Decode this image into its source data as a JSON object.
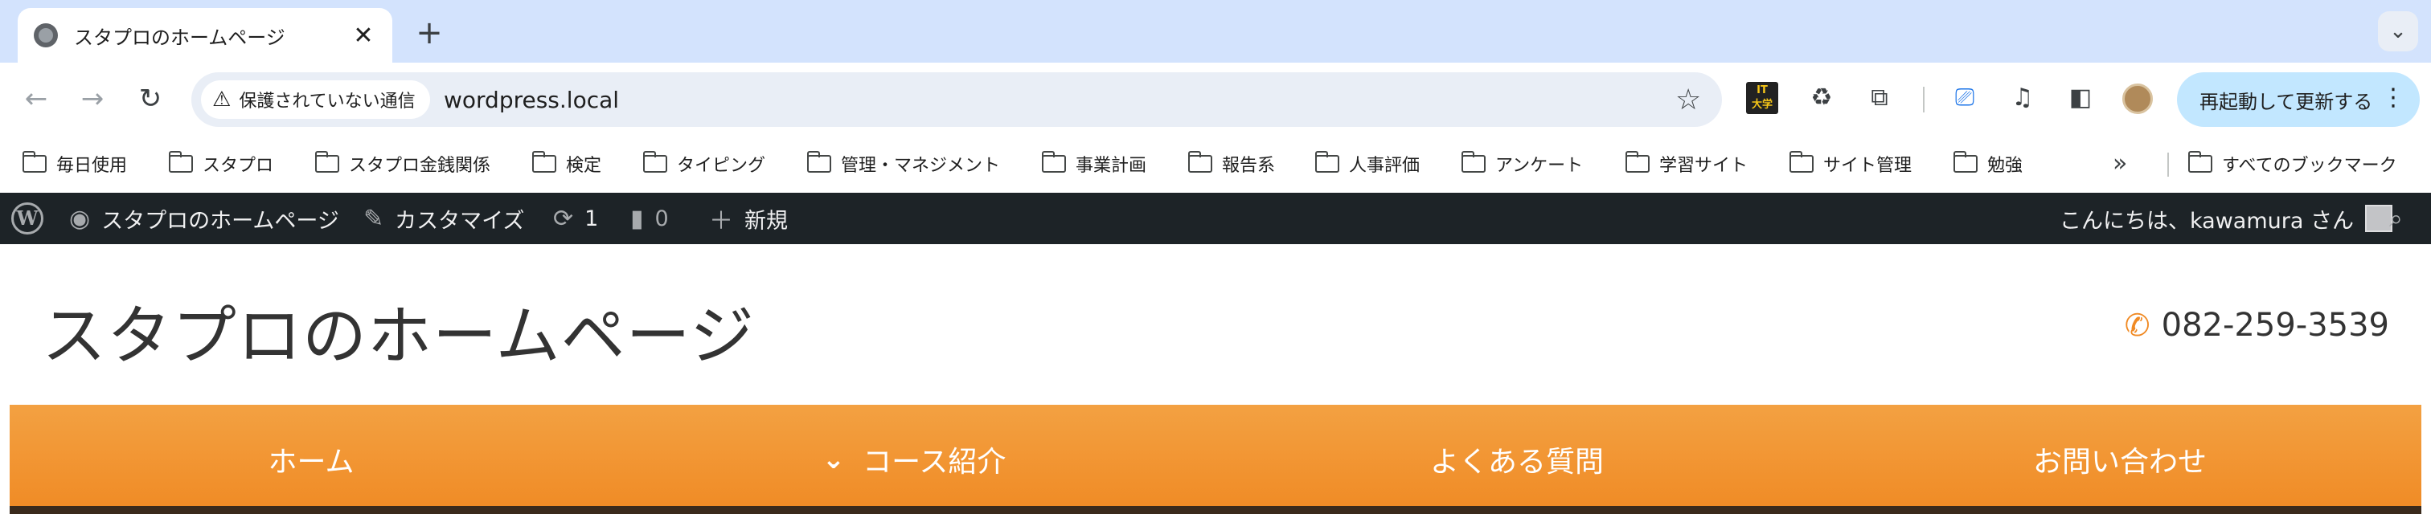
{
  "browser": {
    "tab": {
      "title": "スタプロのホームページ",
      "close": "✕"
    },
    "newtab": "+",
    "tabsearch": "⌄",
    "nav": {
      "back": "←",
      "forward": "→",
      "reload": "↻"
    },
    "omnibox": {
      "security_label": "保護されていない通信",
      "url": "wordpress.local",
      "star": "☆"
    },
    "relaunch_label": "再起動して更新する",
    "extensions": [
      "it-daigaku-icon",
      "recycle-icon",
      "puzzle-icon",
      "cast-icon",
      "media-icon",
      "sidepanel-icon",
      "profile-avatar"
    ]
  },
  "bookmarks": {
    "items": [
      {
        "label": "毎日使用"
      },
      {
        "label": "スタプロ"
      },
      {
        "label": "スタプロ金銭関係"
      },
      {
        "label": "検定"
      },
      {
        "label": "タイピング"
      },
      {
        "label": "管理・マネジメント"
      },
      {
        "label": "事業計画"
      },
      {
        "label": "報告系"
      },
      {
        "label": "人事評価"
      },
      {
        "label": "アンケート"
      },
      {
        "label": "学習サイト"
      },
      {
        "label": "サイト管理"
      },
      {
        "label": "勉強"
      }
    ],
    "more": "»",
    "all_bookmarks": "すべてのブックマーク"
  },
  "adminbar": {
    "site_name": "スタプロのホームページ",
    "customize": "カスタマイズ",
    "updates": "1",
    "comments": "0",
    "new": "新規",
    "greeting": "こんにちは、kawamura さん"
  },
  "site": {
    "title": "スタプロのホームページ",
    "phone": "082-259-3539"
  },
  "nav": {
    "items": [
      {
        "label": "ホーム"
      },
      {
        "label": "コース紹介"
      },
      {
        "label": "よくある質問"
      },
      {
        "label": "お問い合わせ"
      }
    ]
  },
  "colors": {
    "tabstrip": "#d3e3fd",
    "adminbar": "#1d2327",
    "accent_orange": "#f08a24",
    "relaunch": "#c2e7ff"
  }
}
